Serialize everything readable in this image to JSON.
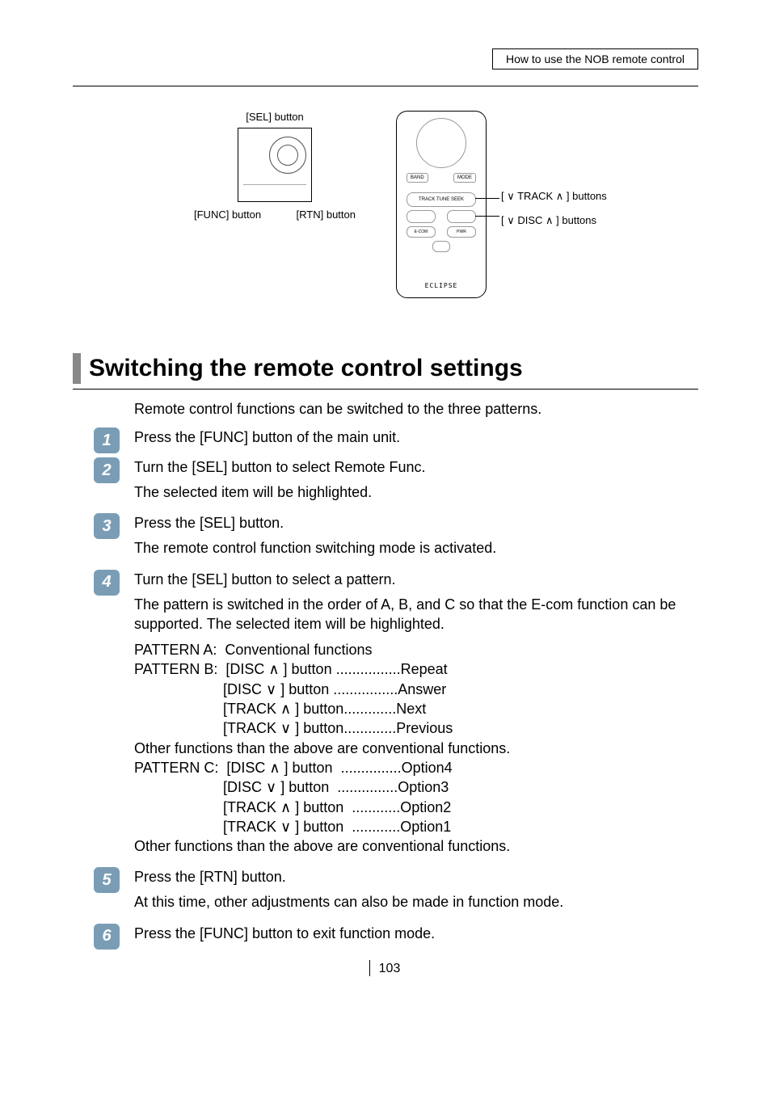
{
  "header": {
    "label": "How to use the NOB remote control"
  },
  "diagram": {
    "sel_label": "[SEL] button",
    "func_label": "[FUNC] button",
    "rtn_label": "[RTN] button",
    "track_label": "[ ∨ TRACK ∧ ] buttons",
    "disc_label": "[ ∨ DISC ∧ ] buttons",
    "remote": {
      "band": "BAND",
      "mode": "MODE",
      "track": "TRACK\nTUNE SEEK",
      "ecom": "E-COM",
      "pwr": "PWR",
      "brand": "ECLIPSE"
    }
  },
  "section": {
    "title": "Switching the remote control settings",
    "intro": "Remote control functions can be switched to the three patterns."
  },
  "steps": [
    {
      "num": "1",
      "head": "Press the [FUNC] button of the main unit."
    },
    {
      "num": "2",
      "head": "Turn the [SEL] button to select Remote Func.",
      "body": [
        "The selected item will be highlighted."
      ]
    },
    {
      "num": "3",
      "head": "Press the [SEL] button.",
      "body": [
        "The remote control function switching mode is activated."
      ]
    },
    {
      "num": "4",
      "head": "Turn the [SEL] button to select a pattern.",
      "body": [
        "The pattern is switched in the order of A, B, and C so that the E-com function can be supported. The selected item will be highlighted."
      ],
      "patterns": [
        "PATTERN A:  Conventional functions",
        "PATTERN B:  [DISC ∧ ] button ................Repeat",
        "                      [DISC ∨ ] button ................Answer",
        "                      [TRACK ∧ ] button.............Next",
        "                      [TRACK ∨ ] button.............Previous",
        "Other functions than the above are conventional functions.",
        "PATTERN C:  [DISC ∧ ] button  ...............Option4",
        "                      [DISC ∨ ] button  ...............Option3",
        "                      [TRACK ∧ ] button  ............Option2",
        "                      [TRACK ∨ ] button  ............Option1",
        "Other functions than the above are conventional functions."
      ]
    },
    {
      "num": "5",
      "head": "Press the [RTN] button.",
      "body": [
        "At this time, other adjustments can also be made in function mode."
      ]
    },
    {
      "num": "6",
      "head": "Press the [FUNC] button to exit function mode."
    }
  ],
  "page_number": "103"
}
